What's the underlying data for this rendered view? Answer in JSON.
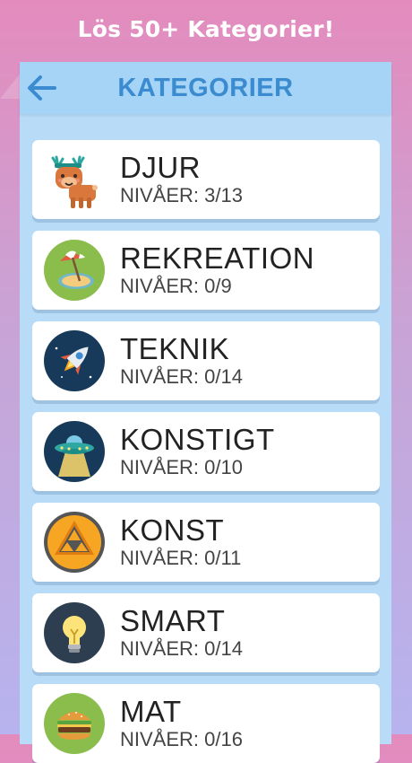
{
  "promo": {
    "text": "Lös 50+ Kategorier!"
  },
  "header": {
    "title": "KATEGORIER",
    "back_icon": "arrow-left-icon"
  },
  "levels_prefix": "NIVÅER:",
  "categories": [
    {
      "name": "DJUR",
      "levels": "NIVÅER: 3/13",
      "icon": "reindeer-icon"
    },
    {
      "name": "REKREATION",
      "levels": "NIVÅER: 0/9",
      "icon": "beach-umbrella-icon"
    },
    {
      "name": "TEKNIK",
      "levels": "NIVÅER: 0/14",
      "icon": "rocket-icon"
    },
    {
      "name": "KONSTIGT",
      "levels": "NIVÅER: 0/10",
      "icon": "ufo-icon"
    },
    {
      "name": "KONST",
      "levels": "NIVÅER: 0/11",
      "icon": "triangle-art-icon"
    },
    {
      "name": "SMART",
      "levels": "NIVÅER: 0/14",
      "icon": "lightbulb-icon"
    },
    {
      "name": "MAT",
      "levels": "NIVÅER: 0/16",
      "icon": "burger-icon"
    }
  ],
  "colors": {
    "accent": "#3a8bd0",
    "header_bg": "#a6d4f6",
    "screen_bg": "#b8dcf8"
  }
}
